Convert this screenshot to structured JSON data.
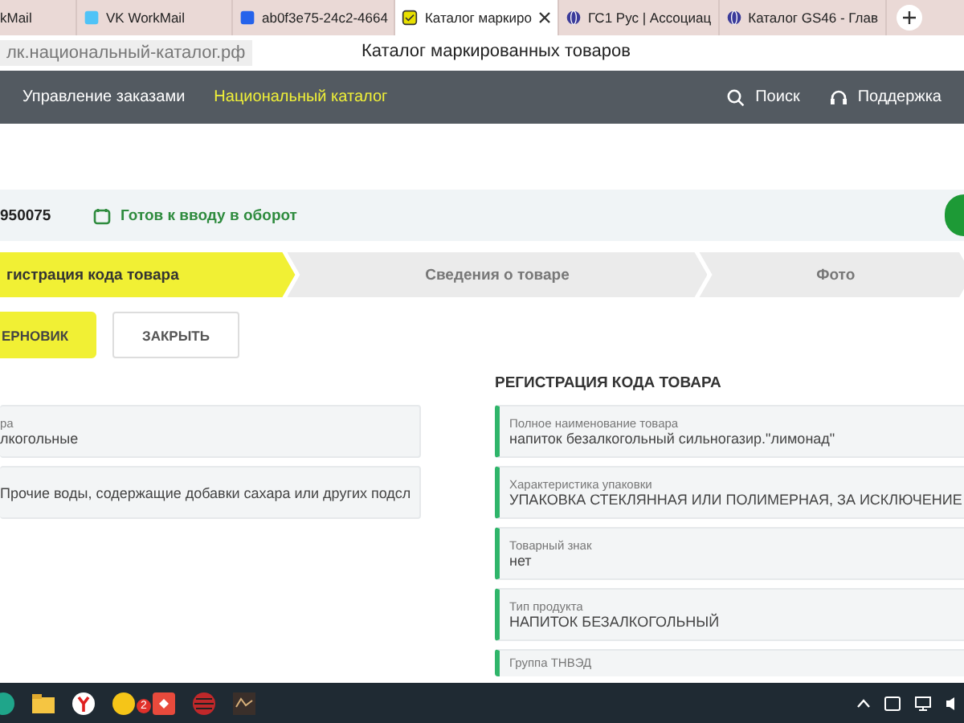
{
  "browser_tabs": [
    {
      "title": "kMail",
      "selected": false
    },
    {
      "title": "VK WorkMail",
      "selected": false
    },
    {
      "title": "ab0f3e75-24c2-4664",
      "selected": false
    },
    {
      "title": "Каталог маркиро",
      "selected": true
    },
    {
      "title": "ГС1 Рус | Ассоциац",
      "selected": false
    },
    {
      "title": "Каталог GS46 - Глав",
      "selected": false
    }
  ],
  "address_bar": {
    "url": "лк.национальный-каталог.рф",
    "page_title": "Каталог маркированных товаров"
  },
  "nav": {
    "items": [
      {
        "label": "Управление заказами",
        "selected": false
      },
      {
        "label": "Национальный каталог",
        "selected": true
      }
    ],
    "actions": [
      {
        "label": "Поиск",
        "kind": "search"
      },
      {
        "label": "Поддержка",
        "kind": "support"
      }
    ]
  },
  "product": {
    "code": "950075",
    "status": "Готов к вводу в оборот"
  },
  "steps": [
    {
      "label": "гистрация кода товара",
      "selected": true
    },
    {
      "label": "Сведения о товаре",
      "selected": false
    },
    {
      "label": "Фото",
      "selected": false
    }
  ],
  "buttons": [
    {
      "label": "ЕРНОВИК",
      "kind": "primary"
    },
    {
      "label": "ЗАКРЫТЬ",
      "kind": "secondary"
    }
  ],
  "left_fields": [
    {
      "label": "ра",
      "value": "лкогольные"
    },
    {
      "value": "Прочие воды, содержащие добавки сахара или других подсл"
    }
  ],
  "section_title": "РЕГИСТРАЦИЯ КОДА ТОВАРА",
  "right_fields": [
    {
      "label": "Полное наименование товара",
      "value": "напиток безалкогольный сильногазир.\"лимонад\""
    },
    {
      "label": "Характеристика упаковки",
      "value": "УПАКОВКА СТЕКЛЯННАЯ ИЛИ ПОЛИМЕРНАЯ, ЗА ИСКЛЮЧЕНИЕ"
    },
    {
      "label": "Товарный знак",
      "value": "нет"
    },
    {
      "label": "Тип продукта",
      "value": "НАПИТОК БЕЗАЛКОГОЛЬНЫЙ"
    },
    {
      "label": "Группа ТНВЭД"
    }
  ],
  "taskbar": {
    "badge": "2"
  }
}
